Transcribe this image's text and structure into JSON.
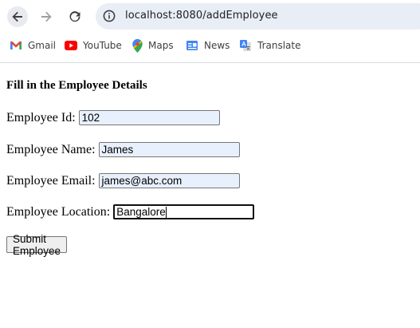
{
  "browser": {
    "url": "localhost:8080/addEmployee",
    "bookmarks": [
      {
        "label": "Gmail",
        "icon": "gmail-icon"
      },
      {
        "label": "YouTube",
        "icon": "youtube-icon"
      },
      {
        "label": "Maps",
        "icon": "maps-icon"
      },
      {
        "label": "News",
        "icon": "news-icon"
      },
      {
        "label": "Translate",
        "icon": "translate-icon"
      }
    ]
  },
  "form": {
    "heading": "Fill in the Employee Details",
    "fields": [
      {
        "label": "Employee Id:",
        "value": "102"
      },
      {
        "label": "Employee Name:",
        "value": "James"
      },
      {
        "label": "Employee Email:",
        "value": "james@abc.com"
      },
      {
        "label": "Employee Location:",
        "value": "Bangalore"
      }
    ],
    "submit_label": "Submit Employee"
  },
  "colors": {
    "autofill_bg": "#e8f0fe",
    "omnibox_bg": "#e9edf5"
  }
}
